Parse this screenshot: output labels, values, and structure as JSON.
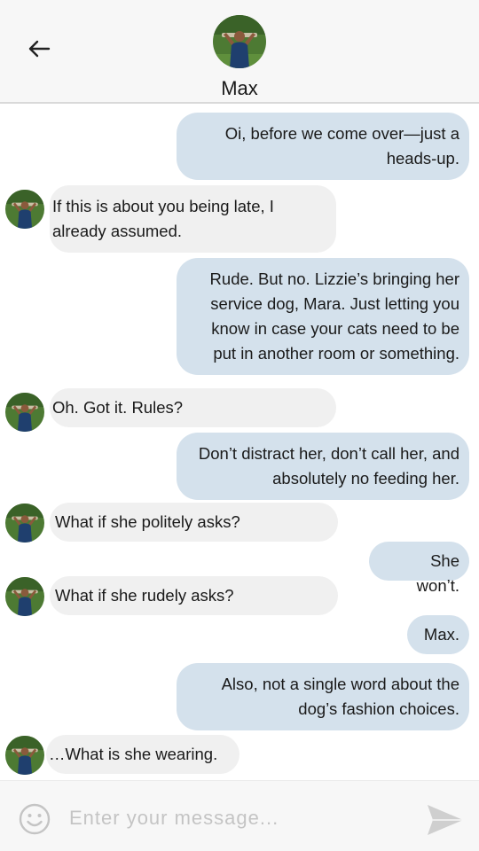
{
  "header": {
    "contact_name": "Max",
    "back_icon": "back-arrow-icon",
    "avatar": "contact-avatar"
  },
  "messages": [
    {
      "dir": "out",
      "text": "Oi, before we come over—just a heads-up."
    },
    {
      "dir": "in",
      "text": "If this is about you being late, I already assumed."
    },
    {
      "dir": "out",
      "text": "Rude. But no. Lizzie’s bringing her service dog, Mara. Just letting you know in case your cats need to be put in another room or something."
    },
    {
      "dir": "in",
      "text": "Oh. Got it. Rules?"
    },
    {
      "dir": "out",
      "text": "Don’t distract her, don’t call her, and absolutely no feeding her."
    },
    {
      "dir": "in",
      "text": "What if she politely asks?"
    },
    {
      "dir": "out",
      "text": "She won’t."
    },
    {
      "dir": "in",
      "text": "What if she rudely asks?"
    },
    {
      "dir": "out",
      "text": "Max."
    },
    {
      "dir": "out",
      "text": "Also, not a single word about the dog’s fashion choices."
    },
    {
      "dir": "in",
      "text": "…What is she wearing."
    }
  ],
  "composer": {
    "placeholder": "Enter your message...",
    "emoji_icon": "emoji-icon",
    "send_icon": "send-icon"
  },
  "colors": {
    "outgoing_bubble": "#d4e1ec",
    "incoming_bubble": "#f0f0f0",
    "header_bg": "#f7f7f7"
  }
}
